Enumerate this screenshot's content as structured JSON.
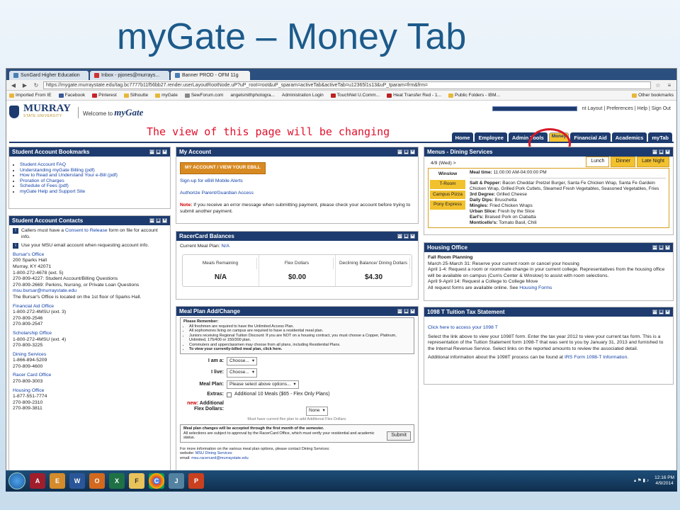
{
  "slide": {
    "title": "myGate – Money Tab"
  },
  "browser": {
    "tabs": [
      "SunGard Higher Education",
      "Inbox - pjones@murrays...",
      "Banner PROD - OFM 11g"
    ],
    "url": "https://mygate.murraystate.edu/tag.bc7777b11f56bb27.render.userLayoutRootNode.uP?uP_root=root&uP_sparam=activeTab&activeTab=u12365l1s13&uP_tparam=frm&frm=",
    "bookmarks": [
      "Imported From IE",
      "Facebook",
      "Pinterest",
      "Silhoutte",
      "myGate",
      "SewForum.com",
      "angelsmithphotogra...",
      "Administration Login",
      "TouchNet U.Comm...",
      "Heat Transfer Red - 1...",
      "Public Folders - IBM..."
    ],
    "other_bookmarks": "Other bookmarks"
  },
  "header": {
    "logo_name": "MURRAY",
    "logo_sub": "STATE UNIVERSITY",
    "welcome_prefix": "Welcome to",
    "welcome_brand": "myGate",
    "toplinks": "nt Layout | Preferences | Help | Sign Out",
    "annotation": "The view of this page  will be changing",
    "nav_tabs": [
      "Home",
      "Employee",
      "Admin Tools",
      "Money",
      "Financial Aid",
      "Academics",
      "myTab"
    ]
  },
  "bookmarks_panel": {
    "title": "Student Account Bookmarks",
    "links": [
      "Student Account FAQ",
      "Understanding myGate Billing (pdf)",
      "How to Read and Understand Your e-Bill (pdf)",
      "Proration of Charges",
      "Schedule of Fees (pdf)",
      "myGate Help and Support Site"
    ]
  },
  "contacts_panel": {
    "title": "Student Account Contacts",
    "note1_pre": "Callers must have a ",
    "note1_link": "Consent to Release",
    "note1_post": " form on file for account info.",
    "note2": "Use your MSU email account when requesting account info.",
    "bursar": [
      "Bursar's Office",
      "200 Sparks Hall",
      "Murray, KY 42071",
      "1-800-272-4678 (ext. 5)",
      "270-809-4227: Student Account/Billing Questions",
      "270-809-2669: Perkins, Nursing, or Private Loan Questions",
      "msu.bursar@murraystate.edu",
      "The Bursar's Office is located on the 1st floor of Sparks Hall."
    ],
    "finaid": [
      "Financial Aid Office",
      "1-800-272-4MSU (ext. 3)",
      "270-809-2546",
      "270-809-2547"
    ],
    "scholarship": [
      "Scholarship Office",
      "1-800-272-4MSU (ext. 4)",
      "270-809-3225"
    ],
    "dining": [
      "Dining Services",
      "1-866-894-5209",
      "270-809-4600"
    ],
    "racer": [
      "Racer Card Office",
      "270-809-3003"
    ],
    "housing": [
      "Housing Office",
      "1-877-551-7774",
      "270-809-2310",
      "270-809-3811"
    ]
  },
  "myaccount_panel": {
    "title": "My Account",
    "button": "MY ACCOUNT / VIEW YOUR EBILL",
    "link1": "Sign-up for eBill Mobile Alerts",
    "link2": "Authorize Parent/Guardian Access",
    "note_label": "Note:",
    "note": " If you receive an error message when submitting payment, please check your account before trying to submit another payment."
  },
  "racercard_panel": {
    "title": "RacerCard Balances",
    "plan_label": "Current Meal Plan:",
    "plan_value": "N/A",
    "cols": [
      {
        "label": "Meals Remaining",
        "value": "N/A"
      },
      {
        "label": "Flex Dollars",
        "value": "$0.00"
      },
      {
        "label": "Declining Balance/ Dining Dollars",
        "value": "$4.30"
      }
    ]
  },
  "mealplan_panel": {
    "title": "Meal Plan Add/Change",
    "remember": "Please Remember:",
    "bullets": [
      "All freshmen are required to have the Unlimited Access Plan.",
      "All sophomores living on campus are required to have a residential meal plan.",
      "Juniors receiving Regional Tuition Discount: If you are NOT on a housing contract, you must choose a Copper, Platinum, Unlimited, 175/400 or 150/300 plan.",
      "Commuters and upperclassmen may choose from all plans, including Residential Plans.",
      "To view your currently-billed meal plan, click here."
    ],
    "iam_label": "I am a:",
    "iam_value": "Choose...",
    "live_label": "I live:",
    "live_value": "Choose...",
    "plan_label": "Meal Plan:",
    "plan_value": "Please select above options...",
    "extras_label": "Extras:",
    "extras_value": "Additional 10 Meals ($65 - Flex Only Plans)",
    "new_label": "new:",
    "flex_label": "Additional Flex Dollars:",
    "flex_value": "None",
    "flex_note": "Must have current flex plan to add Additional Flex Dollars.",
    "change_note1": "Meal plan changes will be accepted through the first month of the semester.",
    "change_note2": "All selections are subject to approval by the RacerCard Office, which must verify your residential and academic status.",
    "submit": "Submit",
    "footer": "For more information on the various meal plan options, please contact Dining Services:",
    "website_label": "website:",
    "website": "MSU Dining Services",
    "email_label": "email:",
    "email": "msu.racercard@murraystate.edu"
  },
  "dining_panel": {
    "title": "Menus - Dining Services",
    "date": "4/9 (Wed) >",
    "meal_tabs": [
      "Lunch",
      "Dinner",
      "Late Night"
    ],
    "locations": [
      "Winslow",
      "T-Room",
      "Campus Pizza",
      "Pony Express"
    ],
    "meal_time_label": "Meal time:",
    "meal_time": "11:00:00 AM-04:00:00 PM",
    "items": [
      {
        "k": "Salt & Pepper:",
        "v": "Bacon Cheddar Pretzel Burger, Santa Fe Chicken Wrap, Santa Fe Gardein Chicken Wrap, Grilled Pork Cutlets, Steamed Fresh Vegetables, Seasoned Vegetables, Fries"
      },
      {
        "k": "3rd Degree:",
        "v": "Grilled Cheese"
      },
      {
        "k": "Daily Dips:",
        "v": "Bruschetta"
      },
      {
        "k": "Mingles:",
        "v": "Fried Chicken Wraps"
      },
      {
        "k": "Urban Slice:",
        "v": "Fresh by the Slice"
      },
      {
        "k": "Earl's:",
        "v": "Braised Pork on Ciabatta"
      },
      {
        "k": "Monticello's:",
        "v": "Tomato Basil, Chili"
      }
    ]
  },
  "housing_panel": {
    "title": "Housing Office",
    "heading": "Fall Room Planning",
    "lines": [
      "March 25-March 31: Reserve your current room or cancel your housing",
      "April 1-4: Request a room or roommate change in your current college. Representatives from the housing office will be available on campus (Curris Center & Winslow) to assist with room selections.",
      "April 9-April 14: Request a College to College Move"
    ],
    "last_pre": "All request forms are available online. See ",
    "last_link": "Housing Forms"
  },
  "tax_panel": {
    "title": "1098 T Tuition Tax Statement",
    "link": "Click here to access your 1098 T",
    "body": "Select the link above to view your 1098T form. Enter the tax year 2012 to view your current tax form. This is a representation of the Tuition Statement form 1098-T that was sent to you by January 31, 2013 and furnished to the Internal Revenue Service. Select links on the reported amounts to review the associated detail.",
    "more_pre": "Additional information about the 1098T process can be found at ",
    "more_link": "IRS Form 1098-T Information",
    "more_post": "."
  },
  "taskbar": {
    "apps": [
      "A",
      "E",
      "W",
      "O",
      "X",
      "F",
      "C",
      "J",
      "P"
    ],
    "time": "12:16 PM",
    "date": "4/9/2014"
  }
}
